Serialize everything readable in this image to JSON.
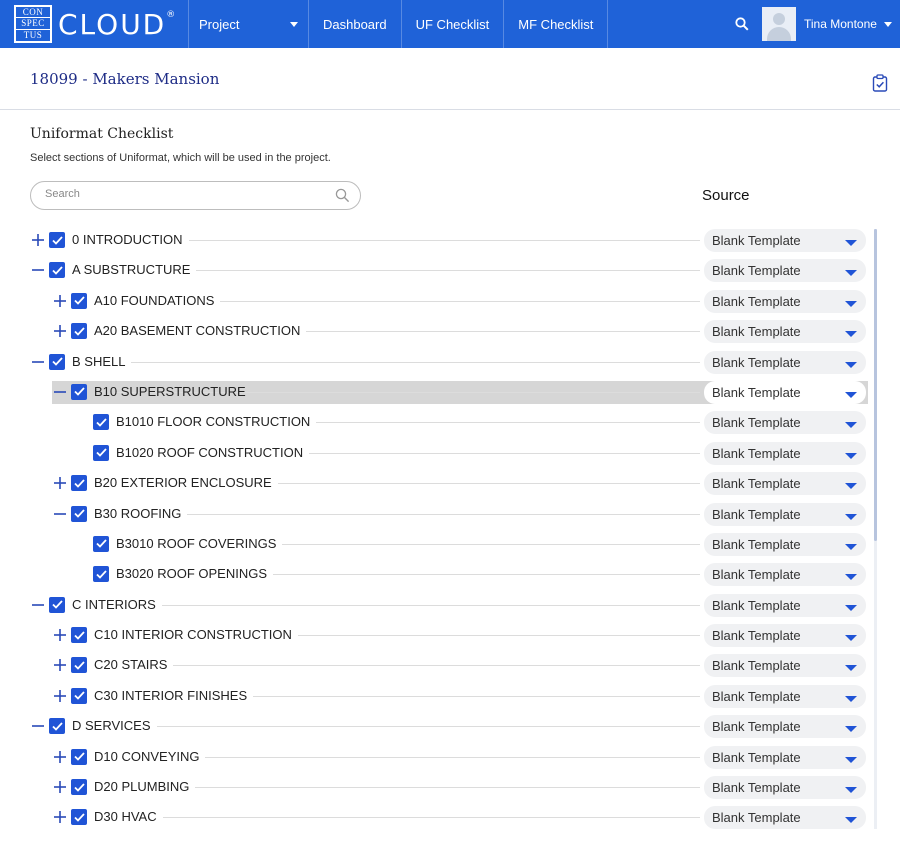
{
  "app": {
    "logo_lines": [
      "CON",
      "SPEC",
      "TUS"
    ],
    "logo_word": "CLOUD",
    "logo_mark": "®"
  },
  "nav": {
    "project_label": "Project",
    "dashboard_label": "Dashboard",
    "uf_checklist_label": "UF Checklist",
    "mf_checklist_label": "MF Checklist",
    "user_name": "Tina Montone"
  },
  "colors": {
    "accent": "#1f62d8",
    "checkbox": "#2054d6",
    "title_text": "#1e2c86"
  },
  "project": {
    "title": "18099 - Makers Mansion"
  },
  "checklist": {
    "title": "Uniformat Checklist",
    "subtitle": "Select sections of Uniformat, which will be used in the project.",
    "search_placeholder": "Search",
    "source_header": "Source"
  },
  "rows": [
    {
      "label": "0 INTRODUCTION",
      "level": 0,
      "expander": "plus",
      "checked": true,
      "source": "Blank Template",
      "selected": false
    },
    {
      "label": "A SUBSTRUCTURE",
      "level": 0,
      "expander": "minus",
      "checked": true,
      "source": "Blank Template",
      "selected": false
    },
    {
      "label": "A10 FOUNDATIONS",
      "level": 1,
      "expander": "plus",
      "checked": true,
      "source": "Blank Template",
      "selected": false
    },
    {
      "label": "A20 BASEMENT CONSTRUCTION",
      "level": 1,
      "expander": "plus",
      "checked": true,
      "source": "Blank Template",
      "selected": false
    },
    {
      "label": "B SHELL",
      "level": 0,
      "expander": "minus",
      "checked": true,
      "source": "Blank Template",
      "selected": false
    },
    {
      "label": "B10 SUPERSTRUCTURE",
      "level": 1,
      "expander": "minus",
      "checked": true,
      "source": "Blank Template",
      "selected": true
    },
    {
      "label": "B1010 FLOOR CONSTRUCTION",
      "level": 2,
      "expander": "none",
      "checked": true,
      "source": "Blank Template",
      "selected": false
    },
    {
      "label": "B1020 ROOF CONSTRUCTION",
      "level": 2,
      "expander": "none",
      "checked": true,
      "source": "Blank Template",
      "selected": false
    },
    {
      "label": "B20 EXTERIOR ENCLOSURE",
      "level": 1,
      "expander": "plus",
      "checked": true,
      "source": "Blank Template",
      "selected": false
    },
    {
      "label": "B30 ROOFING",
      "level": 1,
      "expander": "minus",
      "checked": true,
      "source": "Blank Template",
      "selected": false
    },
    {
      "label": "B3010 ROOF COVERINGS",
      "level": 2,
      "expander": "none",
      "checked": true,
      "source": "Blank Template",
      "selected": false
    },
    {
      "label": "B3020 ROOF OPENINGS",
      "level": 2,
      "expander": "none",
      "checked": true,
      "source": "Blank Template",
      "selected": false
    },
    {
      "label": "C INTERIORS",
      "level": 0,
      "expander": "minus",
      "checked": true,
      "source": "Blank Template",
      "selected": false
    },
    {
      "label": "C10 INTERIOR CONSTRUCTION",
      "level": 1,
      "expander": "plus",
      "checked": true,
      "source": "Blank Template",
      "selected": false
    },
    {
      "label": "C20 STAIRS",
      "level": 1,
      "expander": "plus",
      "checked": true,
      "source": "Blank Template",
      "selected": false
    },
    {
      "label": "C30 INTERIOR FINISHES",
      "level": 1,
      "expander": "plus",
      "checked": true,
      "source": "Blank Template",
      "selected": false
    },
    {
      "label": "D SERVICES",
      "level": 0,
      "expander": "minus",
      "checked": true,
      "source": "Blank Template",
      "selected": false
    },
    {
      "label": "D10 CONVEYING",
      "level": 1,
      "expander": "plus",
      "checked": true,
      "source": "Blank Template",
      "selected": false
    },
    {
      "label": "D20 PLUMBING",
      "level": 1,
      "expander": "plus",
      "checked": true,
      "source": "Blank Template",
      "selected": false
    },
    {
      "label": "D30 HVAC",
      "level": 1,
      "expander": "plus",
      "checked": true,
      "source": "Blank Template",
      "selected": false
    }
  ]
}
